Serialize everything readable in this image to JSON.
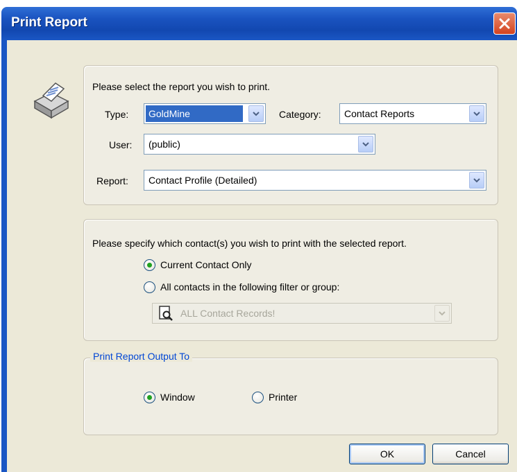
{
  "window": {
    "title": "Print Report",
    "close_icon": "close-icon"
  },
  "report_section": {
    "prompt": "Please select the report you wish to print.",
    "type_label": "Type:",
    "type_value": "GoldMine",
    "category_label": "Category:",
    "category_value": "Contact Reports",
    "user_label": "User:",
    "user_value": "(public)",
    "report_label": "Report:",
    "report_value": "Contact Profile (Detailed)"
  },
  "contacts_section": {
    "prompt": "Please specify which contact(s) you wish to print with the selected report.",
    "option_current": "Current Contact Only",
    "option_all": "All contacts in the following filter or group:",
    "filter_value": "ALL Contact Records!",
    "selected": "current"
  },
  "output_section": {
    "legend": "Print Report Output To",
    "option_window": "Window",
    "option_printer": "Printer",
    "selected": "window"
  },
  "buttons": {
    "ok": "OK",
    "cancel": "Cancel"
  },
  "colors": {
    "title_bar": "#1a53c0",
    "dialog_bg": "#ece9d8",
    "selection": "#316ac5",
    "accent_legend": "#0046d5"
  }
}
